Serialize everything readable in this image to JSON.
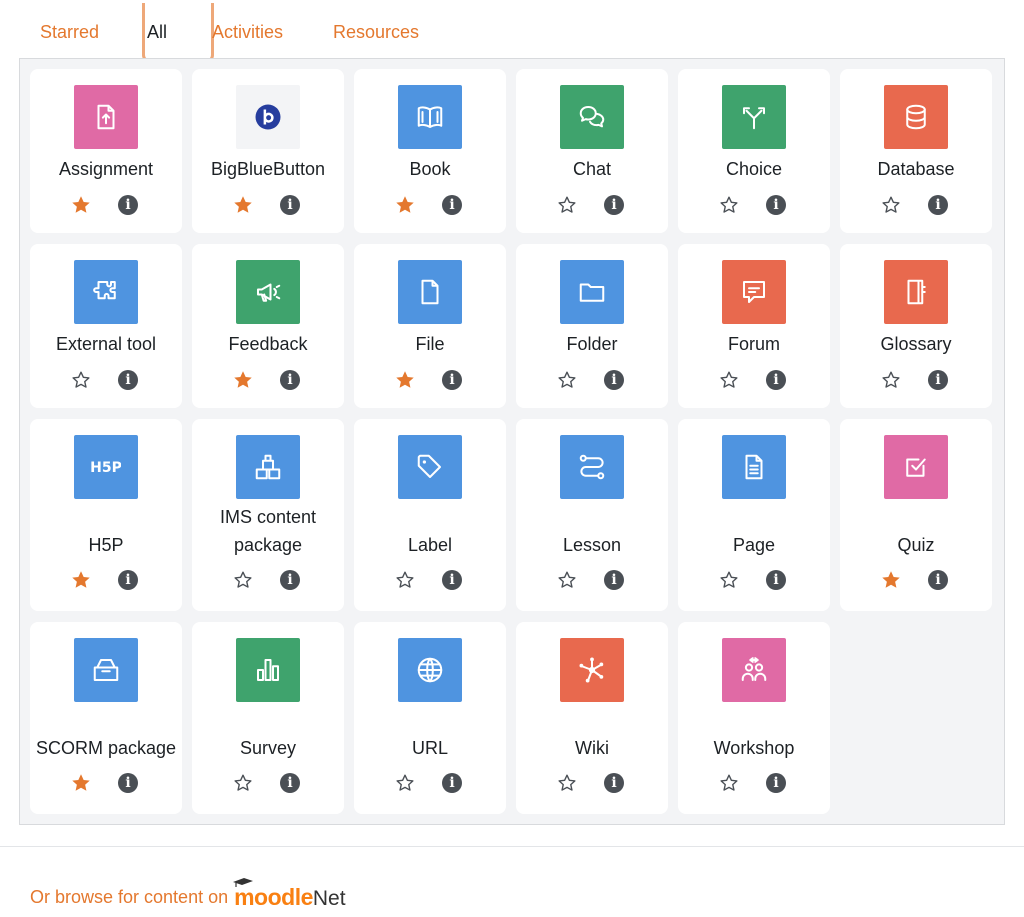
{
  "tabs": [
    {
      "label": "Starred",
      "active": false
    },
    {
      "label": "All",
      "active": true
    },
    {
      "label": "Activities",
      "active": false
    },
    {
      "label": "Resources",
      "active": false
    }
  ],
  "colors": {
    "accent": "#e4782e",
    "star_filled": "#e4782e",
    "tile_pink": "#e06aa5",
    "tile_blue": "#4f94e0",
    "tile_green": "#3fa36d",
    "tile_red": "#e8694e",
    "bbb_blue": "#263d9e"
  },
  "modules": [
    {
      "name": "Assignment",
      "icon": "assignment-icon",
      "tile": "pink",
      "starred": true
    },
    {
      "name": "BigBlueButton",
      "icon": "bigbluebutton-icon",
      "tile": "plain",
      "starred": true
    },
    {
      "name": "Book",
      "icon": "book-icon",
      "tile": "blue",
      "starred": true
    },
    {
      "name": "Chat",
      "icon": "chat-icon",
      "tile": "green",
      "starred": false
    },
    {
      "name": "Choice",
      "icon": "choice-icon",
      "tile": "green",
      "starred": false
    },
    {
      "name": "Database",
      "icon": "database-icon",
      "tile": "red",
      "starred": false
    },
    {
      "name": "External tool",
      "icon": "puzzle-icon",
      "tile": "blue",
      "starred": false
    },
    {
      "name": "Feedback",
      "icon": "megaphone-icon",
      "tile": "green",
      "starred": true
    },
    {
      "name": "File",
      "icon": "file-icon",
      "tile": "blue",
      "starred": true
    },
    {
      "name": "Folder",
      "icon": "folder-icon",
      "tile": "blue",
      "starred": false
    },
    {
      "name": "Forum",
      "icon": "forum-icon",
      "tile": "red",
      "starred": false
    },
    {
      "name": "Glossary",
      "icon": "glossary-icon",
      "tile": "red",
      "starred": false
    },
    {
      "name": "H5P",
      "icon": "h5p-icon",
      "tile": "blue",
      "starred": true
    },
    {
      "name": "IMS content package",
      "icon": "blocks-icon",
      "tile": "blue",
      "starred": false
    },
    {
      "name": "Label",
      "icon": "tag-icon",
      "tile": "blue",
      "starred": false
    },
    {
      "name": "Lesson",
      "icon": "path-icon",
      "tile": "blue",
      "starred": false
    },
    {
      "name": "Page",
      "icon": "page-icon",
      "tile": "blue",
      "starred": false
    },
    {
      "name": "Quiz",
      "icon": "quiz-icon",
      "tile": "pink",
      "starred": true
    },
    {
      "name": "SCORM package",
      "icon": "box-icon",
      "tile": "blue",
      "starred": true
    },
    {
      "name": "Survey",
      "icon": "bar-chart-icon",
      "tile": "green",
      "starred": false
    },
    {
      "name": "URL",
      "icon": "globe-icon",
      "tile": "blue",
      "starred": false
    },
    {
      "name": "Wiki",
      "icon": "network-icon",
      "tile": "red",
      "starred": false
    },
    {
      "name": "Workshop",
      "icon": "workshop-icon",
      "tile": "pink",
      "starred": false
    }
  ],
  "footer": {
    "text": "Or browse for content on",
    "logo_moodle": "moodle",
    "logo_net": "Net"
  }
}
